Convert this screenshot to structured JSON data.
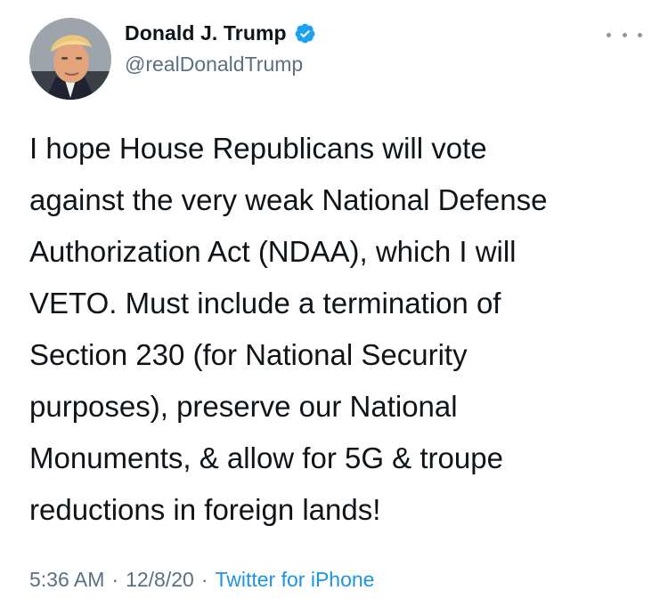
{
  "author": {
    "display_name": "Donald J. Trump",
    "handle": "@realDonaldTrump",
    "verified": true,
    "avatar_icon": "profile-photo"
  },
  "tweet": {
    "lines": [
      "I hope House Republicans will vote",
      "against the very weak National Defense",
      "Authorization Act (NDAA), which I will",
      "VETO. Must include a termination of",
      "Section 230 (for National Security",
      "purposes), preserve our National",
      "Monuments, & allow for 5G & troupe",
      "reductions in foreign lands!"
    ]
  },
  "meta": {
    "time": "5:36 AM",
    "separator": "·",
    "date": "12/8/20",
    "source": "Twitter for iPhone"
  },
  "colors": {
    "text": "#0f1419",
    "secondary": "#5b7083",
    "link": "#1b95e0",
    "verified_badge": "#1da1f2"
  },
  "icons": {
    "more": "more-horizontal-icon",
    "verified": "verified-badge-icon"
  }
}
